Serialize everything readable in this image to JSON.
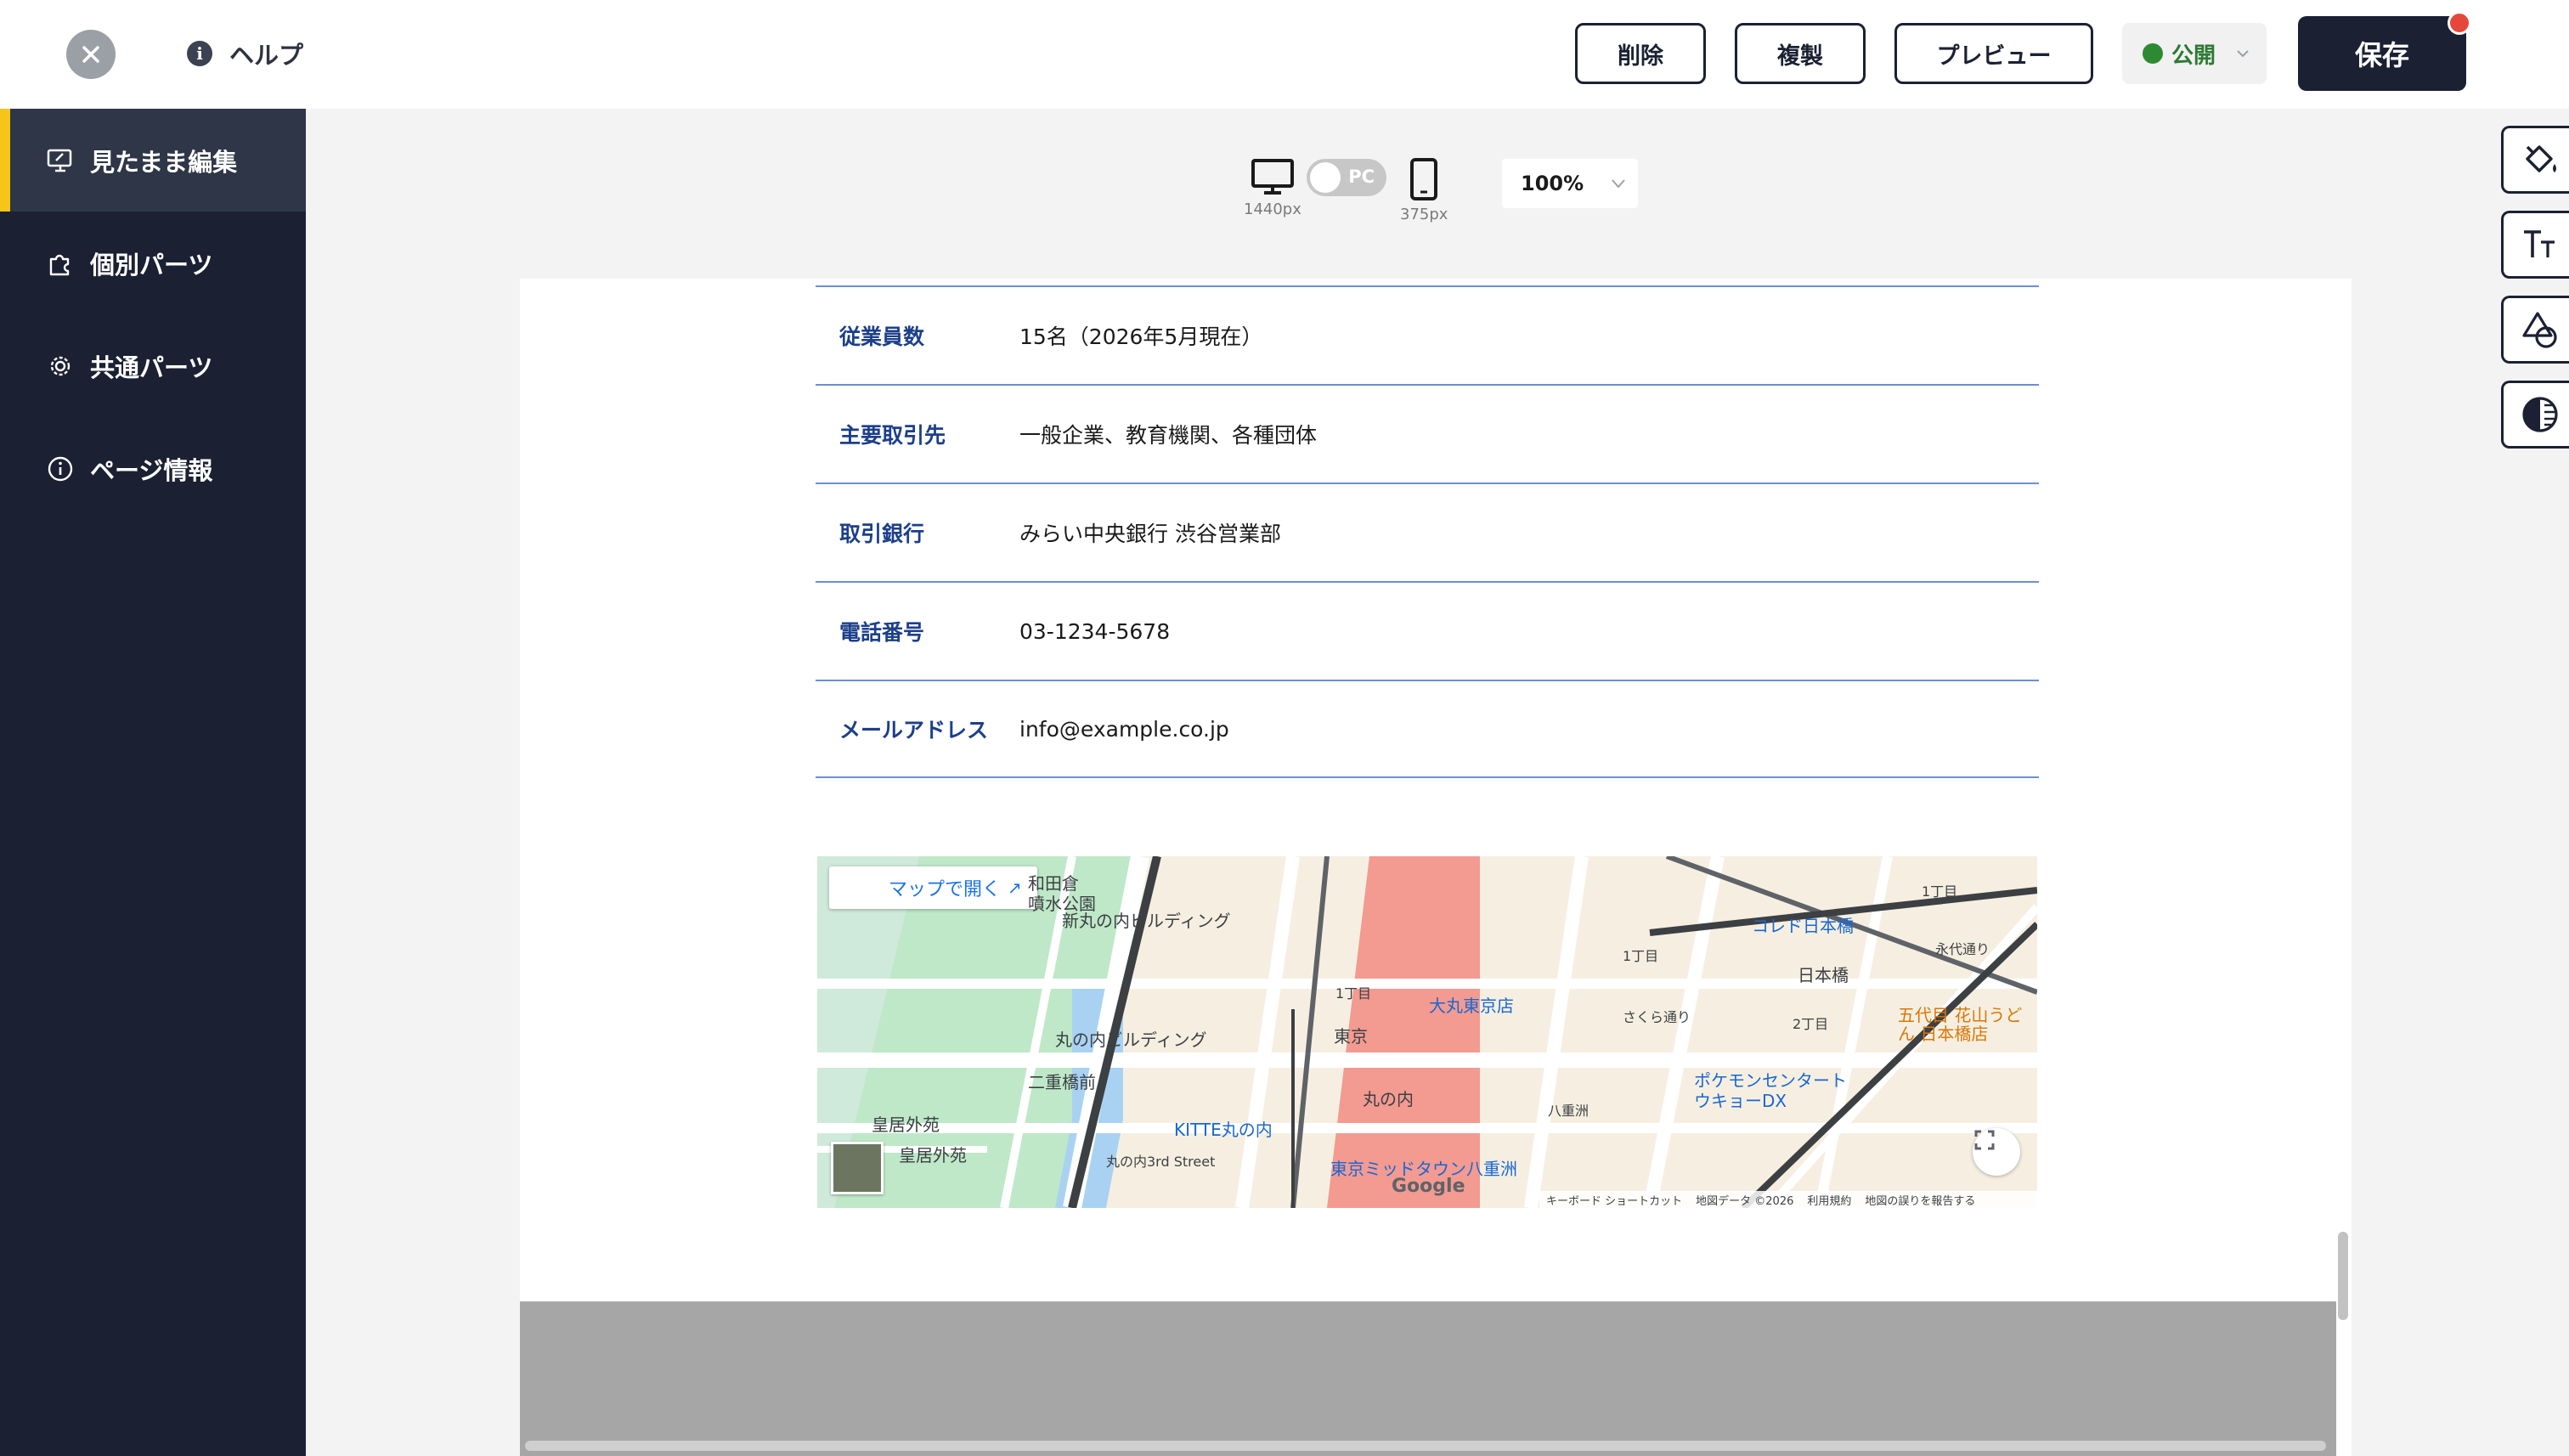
{
  "header": {
    "help_label": "ヘルプ",
    "delete_label": "削除",
    "duplicate_label": "複製",
    "preview_label": "プレビュー",
    "status_label": "公開",
    "save_label": "保存"
  },
  "sidebar": {
    "items": [
      {
        "label": "見たまま編集",
        "icon": "monitor-edit-icon",
        "active": true
      },
      {
        "label": "個別パーツ",
        "icon": "puzzle-icon",
        "active": false
      },
      {
        "label": "共通パーツ",
        "icon": "gear-icon",
        "active": false
      },
      {
        "label": "ページ情報",
        "icon": "info-icon",
        "active": false
      }
    ]
  },
  "viewbar": {
    "pc_caption": "1440px",
    "toggle_label": "PC",
    "mobile_caption": "375px",
    "zoom": "100%"
  },
  "company_info": {
    "rows": [
      {
        "label": "従業員数",
        "value": "15名（2026年5月現在）"
      },
      {
        "label": "主要取引先",
        "value": "一般企業、教育機関、各種団体"
      },
      {
        "label": "取引銀行",
        "value": "みらい中央銀行 渋谷営業部"
      },
      {
        "label": "電話番号",
        "value": "03-1234-5678"
      },
      {
        "label": "メールアドレス",
        "value": "info@example.co.jp"
      }
    ]
  },
  "map": {
    "open_label": "マップで開く",
    "labels": {
      "wadakura": "和田倉",
      "fountain": "噴水公園",
      "shinmaru": "新丸の内ビルディング",
      "marunouchi_bldg": "丸の内ビルディング",
      "nijubashi": "二重橋前",
      "kokyo_gaien": "皇居外苑",
      "kokyo_gaien2": "皇居外苑",
      "kitte": "KITTE丸の内",
      "street": "丸の内3rd Street",
      "tokyo": "東京",
      "daimaru": "大丸東京店",
      "marunouchi": "丸の内",
      "tokyo_midtown": "東京ミッドタウン八重洲",
      "chome1": "1丁目",
      "chome1b": "1丁目",
      "chome1c": "1丁目",
      "chome2": "2丁目",
      "coredo": "コレド日本橋",
      "nihonbashi": "日本橋",
      "hanayama": "五代目 花山うどん 日本橋店",
      "pokemon": "ポケモンセンタートウキョーDX",
      "yaesu": "八重洲",
      "sakura": "さくら通り",
      "eitai": "永代通り"
    },
    "footer": [
      "キーボード ショートカット",
      "地図データ ©2026",
      "利用規約",
      "地図の誤りを報告する"
    ],
    "google": "Google"
  },
  "colors": {
    "sidebar_bg": "#1b2133",
    "accent_yellow": "#f5c518",
    "table_label": "#1c3f8a",
    "table_rule": "#6b8fd6",
    "status_green": "#2d8a32",
    "notify_red": "#e5483a"
  },
  "tools": [
    "paint-bucket-icon",
    "text-size-icon",
    "shapes-icon",
    "contrast-icon"
  ]
}
